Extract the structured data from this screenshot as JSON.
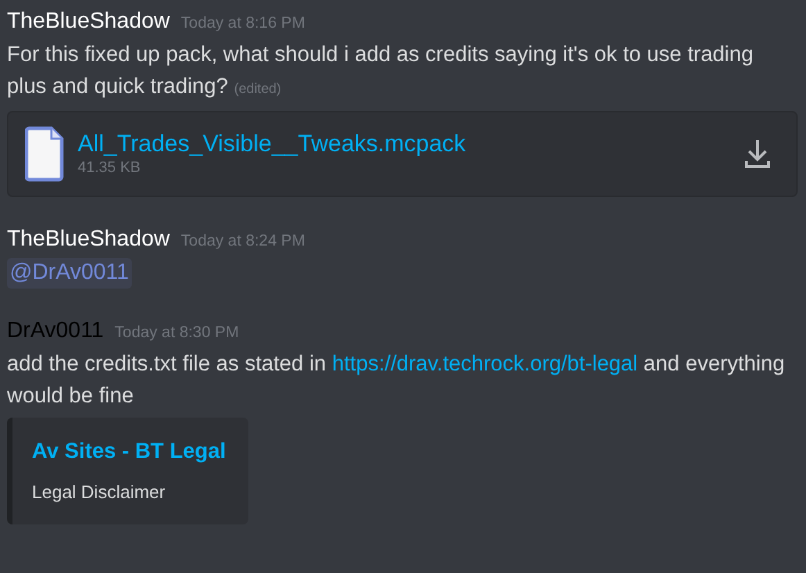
{
  "messages": [
    {
      "author": "TheBlueShadow",
      "color": "#ffffff",
      "time": "Today at 8:16 PM",
      "content": [
        {
          "kind": "text",
          "text": "For this fixed up pack, what should i add as credits saying it's ok to use trading plus and quick trading?"
        }
      ],
      "edited": "(edited)",
      "attachment": {
        "name": "All_Trades_Visible__Tweaks.mcpack",
        "size": "41.35 KB"
      }
    },
    {
      "author": "TheBlueShadow",
      "color": "#ffffff",
      "time": "Today at 8:24 PM",
      "content": [
        {
          "kind": "mention",
          "text": "@DrAv0011"
        }
      ]
    },
    {
      "author": "DrAv0011",
      "color": "#000000",
      "time": "Today at 8:30 PM",
      "content": [
        {
          "kind": "text",
          "text": "add the credits.txt file as stated in "
        },
        {
          "kind": "link",
          "text": "https://drav.techrock.org/bt-legal"
        },
        {
          "kind": "text",
          "text": " and everything would be fine"
        }
      ],
      "embed": {
        "title": "Av Sites - BT Legal",
        "description": "Legal Disclaimer"
      }
    }
  ]
}
